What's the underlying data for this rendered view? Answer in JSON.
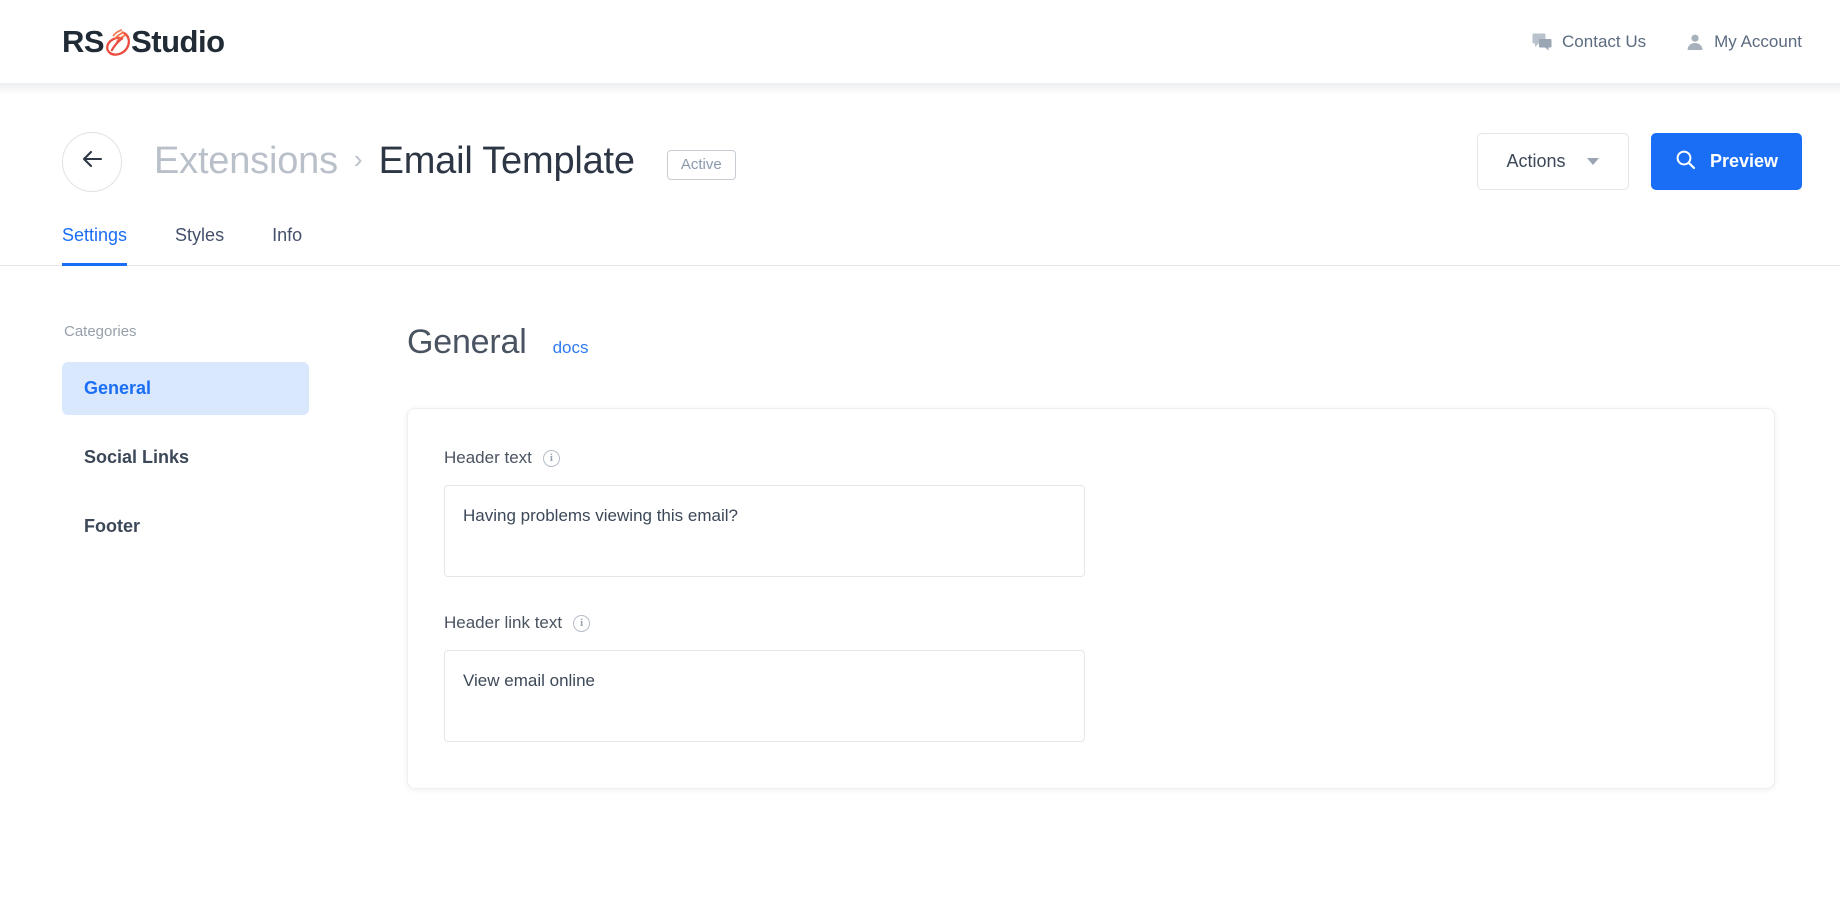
{
  "brand": {
    "name_part1": "RS",
    "name_part2": "Studio",
    "mark_icon": "rs-swoosh-logo-icon",
    "mark_color": "#ea4c3f",
    "text_color": "#212b36"
  },
  "topbar": {
    "links": [
      {
        "label": "Contact Us",
        "icon": "chat-bubble-icon"
      },
      {
        "label": "My Account",
        "icon": "user-account-icon"
      }
    ]
  },
  "page_header": {
    "back_icon": "arrow-left-icon",
    "breadcrumb": {
      "parent": "Extensions",
      "separator": "›",
      "current": "Email Template"
    },
    "status_badge": "Active",
    "actions_button": {
      "label": "Actions",
      "icon": "chevron-down-icon"
    },
    "preview_button": {
      "label": "Preview",
      "icon": "search-icon",
      "color": "#1a6ef5"
    }
  },
  "tabs": {
    "active": "Settings",
    "items": [
      {
        "label": "Settings",
        "active": true
      },
      {
        "label": "Styles",
        "active": false
      },
      {
        "label": "Info",
        "active": false
      }
    ],
    "accent_color": "#1a6ef5"
  },
  "sidebar": {
    "title": "Categories",
    "items": [
      {
        "label": "General",
        "active": true
      },
      {
        "label": "Social Links",
        "active": false
      },
      {
        "label": "Footer",
        "active": false
      }
    ],
    "active_bg": "#d9e8fd",
    "active_color": "#1a6ef5"
  },
  "main": {
    "section_title": "General",
    "docs_link": "docs",
    "fields": [
      {
        "label": "Header text",
        "info_icon": "info-circle-icon",
        "value": "Having problems viewing this email?",
        "placeholder": ""
      },
      {
        "label": "Header link text",
        "info_icon": "info-circle-icon",
        "value": "View email online",
        "placeholder": ""
      }
    ]
  }
}
